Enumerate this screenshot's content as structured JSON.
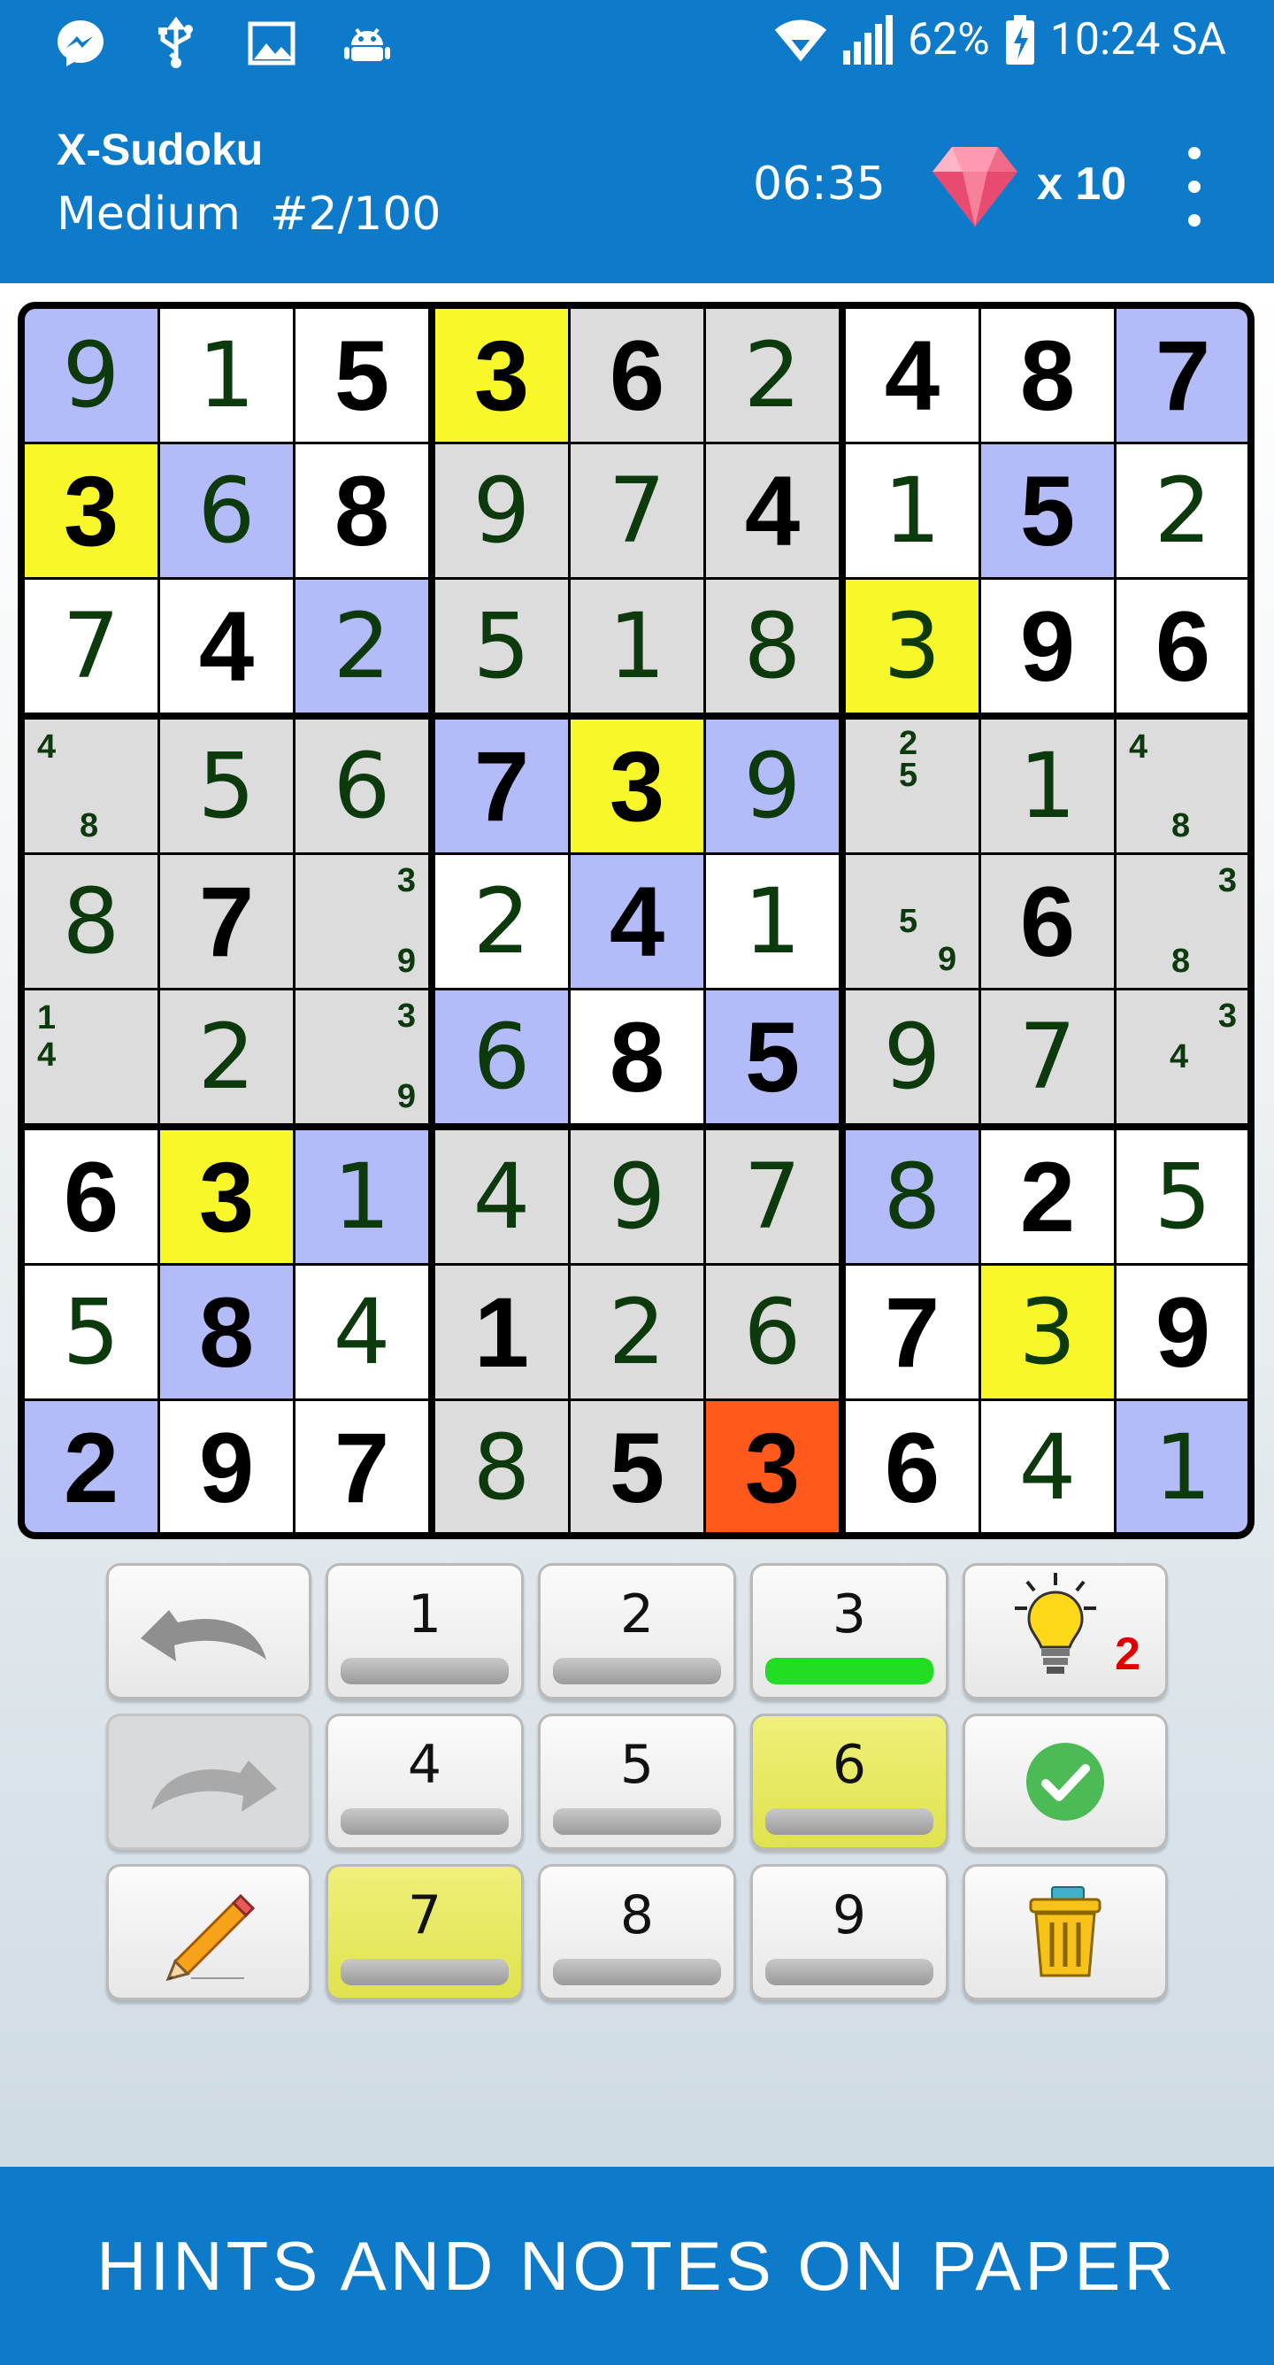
{
  "status_bar": {
    "battery": "62%",
    "time": "10:24 SA",
    "icons": [
      "messenger-icon",
      "usb-icon",
      "image-icon",
      "android-icon",
      "wifi-icon",
      "signal-icon",
      "battery-charging-icon"
    ]
  },
  "header": {
    "title": "X-Sudoku",
    "subtitle": "Medium  #2/100",
    "timer": "06:35",
    "gems": "x 10"
  },
  "board": {
    "rows": [
      [
        "9",
        "1",
        "5",
        "3",
        "6",
        "2",
        "4",
        "8",
        "7"
      ],
      [
        "3",
        "6",
        "8",
        "9",
        "7",
        "4",
        "1",
        "5",
        "2"
      ],
      [
        "7",
        "4",
        "2",
        "5",
        "1",
        "8",
        "3",
        "9",
        "6"
      ],
      [
        "",
        "5",
        "6",
        "7",
        "3",
        "9",
        "",
        "1",
        ""
      ],
      [
        "8",
        "7",
        "",
        "2",
        "4",
        "1",
        "",
        "6",
        ""
      ],
      [
        "",
        "2",
        "",
        "6",
        "8",
        "5",
        "9",
        "7",
        ""
      ],
      [
        "6",
        "3",
        "1",
        "4",
        "9",
        "7",
        "8",
        "2",
        "5"
      ],
      [
        "5",
        "8",
        "4",
        "1",
        "2",
        "6",
        "7",
        "3",
        "9"
      ],
      [
        "2",
        "9",
        "7",
        "8",
        "5",
        "3",
        "6",
        "4",
        "1"
      ]
    ],
    "given": [
      [
        0,
        0,
        1,
        1,
        1,
        0,
        1,
        1,
        1
      ],
      [
        1,
        0,
        1,
        0,
        0,
        1,
        0,
        1,
        0
      ],
      [
        0,
        1,
        0,
        0,
        0,
        0,
        0,
        1,
        1
      ],
      [
        0,
        0,
        0,
        1,
        1,
        0,
        0,
        0,
        0
      ],
      [
        0,
        1,
        0,
        0,
        1,
        0,
        0,
        1,
        0
      ],
      [
        0,
        0,
        0,
        0,
        1,
        1,
        0,
        0,
        0
      ],
      [
        1,
        1,
        0,
        0,
        0,
        0,
        0,
        1,
        0
      ],
      [
        0,
        1,
        0,
        1,
        0,
        0,
        1,
        0,
        1
      ],
      [
        1,
        1,
        1,
        0,
        1,
        1,
        1,
        0,
        0
      ]
    ],
    "highlight": [
      [
        "B",
        "W",
        "W",
        "Y",
        "G",
        "G",
        "W",
        "W",
        "B"
      ],
      [
        "Y",
        "B",
        "W",
        "G",
        "G",
        "G",
        "W",
        "B",
        "W"
      ],
      [
        "W",
        "W",
        "B",
        "G",
        "G",
        "G",
        "Y",
        "W",
        "W"
      ],
      [
        "G",
        "G",
        "G",
        "B",
        "Y",
        "B",
        "G",
        "G",
        "G"
      ],
      [
        "G",
        "G",
        "G",
        "W",
        "B",
        "W",
        "G",
        "G",
        "G"
      ],
      [
        "G",
        "G",
        "G",
        "B",
        "W",
        "B",
        "G",
        "G",
        "G"
      ],
      [
        "W",
        "Y",
        "B",
        "G",
        "G",
        "G",
        "B",
        "W",
        "W"
      ],
      [
        "W",
        "B",
        "W",
        "G",
        "G",
        "G",
        "W",
        "Y",
        "W"
      ],
      [
        "B",
        "W",
        "W",
        "G",
        "G",
        "R",
        "W",
        "W",
        "B"
      ]
    ],
    "colors": {
      "B": "#b3bcf8",
      "W": "#ffffff",
      "Y": "#f7f72a",
      "G": "#dcdcdc",
      "R": "#ff5a1c"
    },
    "notes": [
      {
        "row": 3,
        "col": 0,
        "items": [
          {
            "d": "4",
            "pos": "tl"
          },
          {
            "d": "8",
            "pos": "bc"
          }
        ]
      },
      {
        "row": 3,
        "col": 6,
        "items": [
          {
            "d": "2",
            "pos": "tc"
          },
          {
            "d": "5",
            "pos": "mc"
          }
        ]
      },
      {
        "row": 3,
        "col": 8,
        "items": [
          {
            "d": "4",
            "pos": "tl"
          },
          {
            "d": "8",
            "pos": "bc"
          }
        ]
      },
      {
        "row": 4,
        "col": 2,
        "items": [
          {
            "d": "3",
            "pos": "tr"
          },
          {
            "d": "9",
            "pos": "br"
          }
        ]
      },
      {
        "row": 4,
        "col": 6,
        "items": [
          {
            "d": "5",
            "pos": "ml"
          },
          {
            "d": "9",
            "pos": "bm"
          }
        ]
      },
      {
        "row": 4,
        "col": 8,
        "items": [
          {
            "d": "3",
            "pos": "tr"
          },
          {
            "d": "8",
            "pos": "bc"
          }
        ]
      },
      {
        "row": 5,
        "col": 0,
        "items": [
          {
            "d": "1",
            "pos": "tl"
          },
          {
            "d": "4",
            "pos": "tl2"
          }
        ]
      },
      {
        "row": 5,
        "col": 2,
        "items": [
          {
            "d": "3",
            "pos": "tr"
          },
          {
            "d": "9",
            "pos": "br"
          }
        ]
      },
      {
        "row": 5,
        "col": 8,
        "items": [
          {
            "d": "3",
            "pos": "tr"
          },
          {
            "d": "4",
            "pos": "ml"
          }
        ]
      }
    ]
  },
  "keypad": {
    "numbers": [
      {
        "label": "1",
        "completed": false,
        "highlighted": false
      },
      {
        "label": "2",
        "completed": false,
        "highlighted": false
      },
      {
        "label": "3",
        "completed": true,
        "highlighted": false
      },
      {
        "label": "4",
        "completed": false,
        "highlighted": false
      },
      {
        "label": "5",
        "completed": false,
        "highlighted": false
      },
      {
        "label": "6",
        "completed": false,
        "highlighted": true
      },
      {
        "label": "7",
        "completed": false,
        "highlighted": true
      },
      {
        "label": "8",
        "completed": false,
        "highlighted": false
      },
      {
        "label": "9",
        "completed": false,
        "highlighted": false
      }
    ],
    "hint_count": "2",
    "tools": [
      "undo-icon",
      "redo-icon",
      "pencil-icon",
      "lightbulb-icon",
      "checkmark-icon",
      "trash-icon"
    ]
  },
  "banner": {
    "text": "HINTS AND NOTES ON PAPER"
  }
}
